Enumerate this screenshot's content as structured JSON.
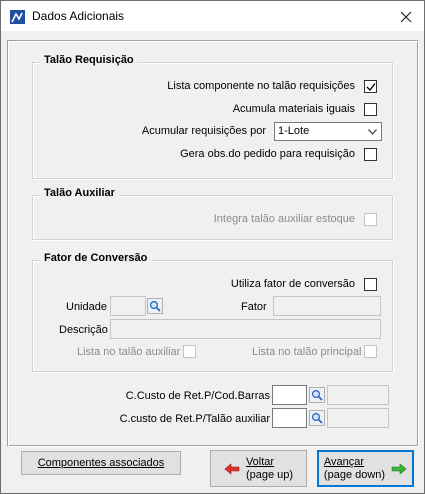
{
  "window": {
    "title": "Dados Adicionais"
  },
  "talao_requisicao": {
    "title": "Talão Requisição",
    "lista_componente_label": "Lista componente no talão requisições",
    "lista_componente_checked": true,
    "acumula_materiais_label": "Acumula materiais iguais",
    "acumula_materiais_checked": false,
    "acumular_por_label": "Acumular requisições por",
    "acumular_por_value": "1-Lote",
    "gera_obs_label": "Gera obs.do pedido para requisição",
    "gera_obs_checked": false
  },
  "talao_auxiliar": {
    "title": "Talão Auxiliar",
    "integra_label": "Integra talão auxiliar estoque",
    "integra_checked": false
  },
  "fator_conversao": {
    "title": "Fator de Conversão",
    "utiliza_label": "Utiliza fator de conversão",
    "utiliza_checked": false,
    "unidade_label": "Unidade",
    "unidade_value": "",
    "fator_label": "Fator",
    "fator_value": "",
    "descricao_label": "Descrição",
    "descricao_value": "",
    "lista_auxiliar_label": "Lista no talão auxiliar",
    "lista_principal_label": "Lista no talão principal"
  },
  "custos": {
    "barras_label": "C.Custo de Ret.P/Cod.Barras",
    "barras_code": "",
    "barras_desc": "",
    "talao_auxiliar_label": "C.custo de Ret.P/Talão auxiliar",
    "talao_auxiliar_code": "",
    "talao_auxiliar_desc": ""
  },
  "buttons": {
    "componentes_label": "Componentes associados",
    "voltar_line1": "Voltar",
    "voltar_line2": "(page up)",
    "avancar_line1": "Avançar",
    "avancar_line2": "(page down)"
  },
  "icons": {
    "app": "app-icon",
    "close": "close-icon",
    "check": "check-icon",
    "dropdown": "chevron-down-icon",
    "lookup": "magnifier-icon",
    "back": "arrow-left-icon",
    "forward": "arrow-right-icon"
  },
  "colors": {
    "back_arrow": "#e0302a",
    "forward_arrow": "#3cb23c",
    "default_button_border": "#0078d7",
    "app_icon": "#1f4fa0"
  }
}
